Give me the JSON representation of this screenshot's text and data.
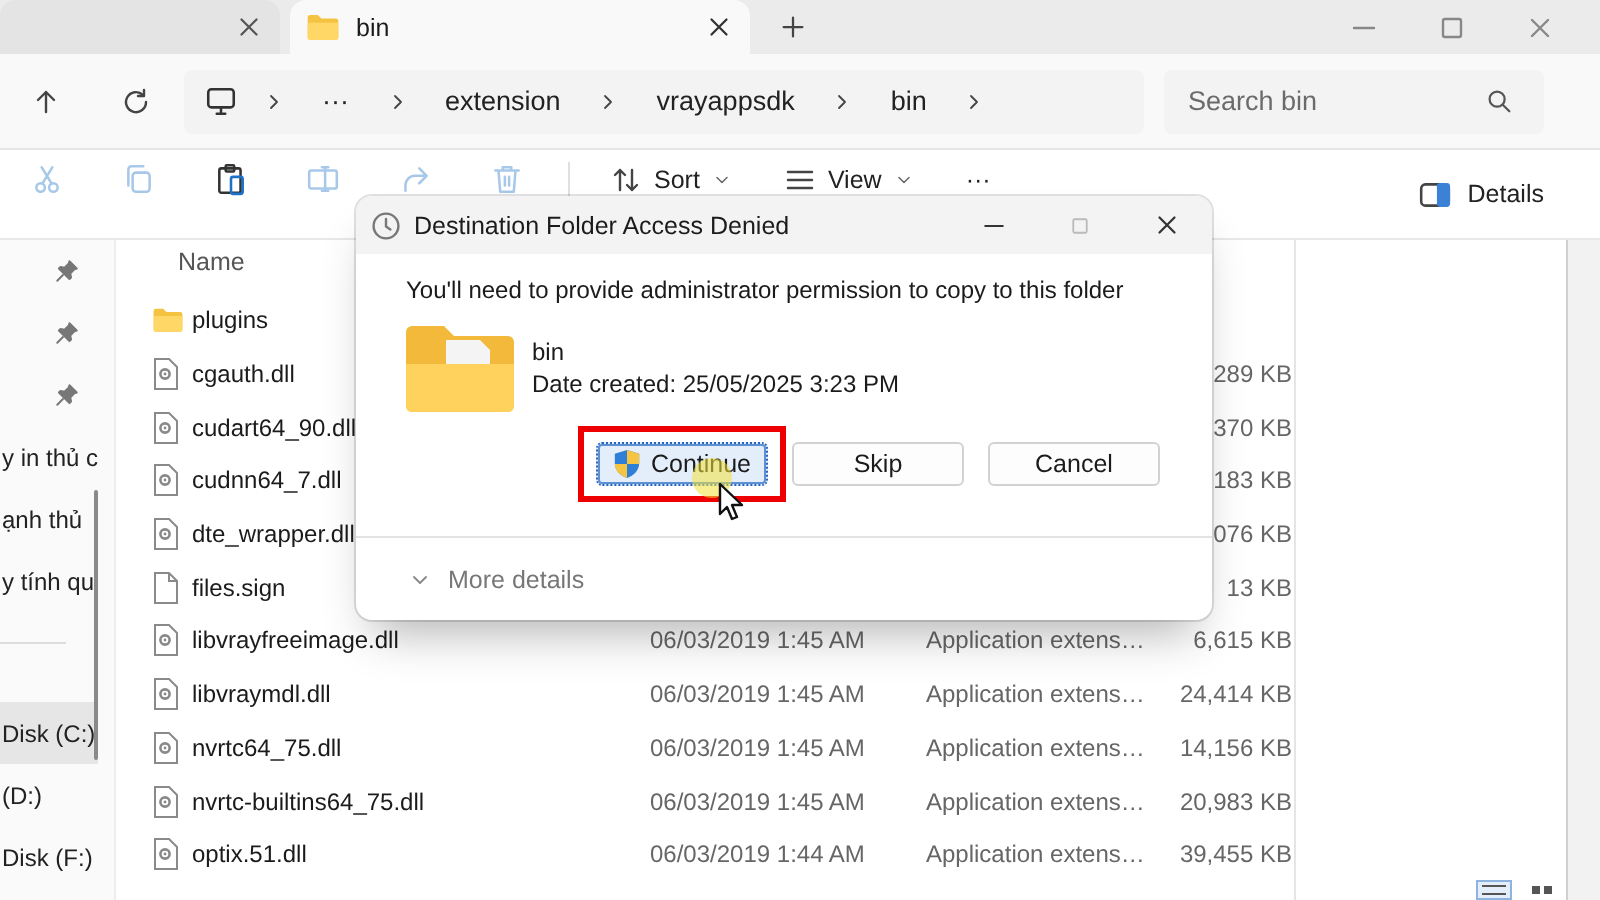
{
  "tabs": [
    {
      "selected": false
    },
    {
      "label": "bin",
      "selected": true
    }
  ],
  "address": {
    "overflow": "···",
    "crumbs": [
      "extension",
      "vrayappsdk",
      "bin"
    ],
    "search": {
      "placeholder": "Search bin"
    }
  },
  "commands": [
    {
      "kind": "cut",
      "disabled": true
    },
    {
      "kind": "copy",
      "disabled": true
    },
    {
      "kind": "paste",
      "disabled": false
    },
    {
      "kind": "rename",
      "disabled": true
    },
    {
      "kind": "share",
      "disabled": true
    },
    {
      "kind": "delete",
      "disabled": true
    }
  ],
  "menus": [
    {
      "kind": "sort",
      "label": "Sort"
    },
    {
      "kind": "view",
      "label": "View"
    },
    {
      "kind": "more",
      "label": "···"
    }
  ],
  "details_button": {
    "label": "Details"
  },
  "sidebar": {
    "items": [
      {
        "pinned": true,
        "selected": false
      },
      {
        "pinned": true,
        "selected": false
      },
      {
        "pinned": true,
        "selected": false
      },
      {
        "label": "y in thủ c",
        "pinned": false,
        "selected": false
      },
      {
        "label": "ạnh thủ",
        "pinned": false,
        "selected": false
      },
      {
        "label": "y tính qu",
        "pinned": false,
        "selected": false
      },
      {
        "kind": "divider"
      },
      {
        "label": "Disk (C:)",
        "pinned": false,
        "selected": true
      },
      {
        "label": "(D:)",
        "pinned": false,
        "selected": false
      },
      {
        "label": "Disk (F:)",
        "pinned": false,
        "selected": false
      }
    ]
  },
  "files": {
    "columns": [
      "Name"
    ],
    "rows": [
      {
        "kind": "folder",
        "name": "plugins"
      },
      {
        "kind": "dll",
        "name": "cgauth.dll",
        "size": "289 KB"
      },
      {
        "kind": "dll",
        "name": "cudart64_90.dll",
        "size": "370 KB"
      },
      {
        "kind": "dll",
        "name": "cudnn64_7.dll",
        "size": "183 KB"
      },
      {
        "kind": "dll",
        "name": "dte_wrapper.dll",
        "size": "076 KB"
      },
      {
        "kind": "file",
        "name": "files.sign",
        "size": "13 KB"
      },
      {
        "kind": "dll",
        "name": "libvrayfreeimage.dll",
        "date": "06/03/2019 1:45 AM",
        "type": "Application extens…",
        "size": "6,615 KB"
      },
      {
        "kind": "dll",
        "name": "libvraymdl.dll",
        "date": "06/03/2019 1:45 AM",
        "type": "Application extens…",
        "size": "24,414 KB"
      },
      {
        "kind": "dll",
        "name": "nvrtc64_75.dll",
        "date": "06/03/2019 1:45 AM",
        "type": "Application extens…",
        "size": "14,156 KB"
      },
      {
        "kind": "dll",
        "name": "nvrtc-builtins64_75.dll",
        "date": "06/03/2019 1:45 AM",
        "type": "Application extens…",
        "size": "20,983 KB"
      },
      {
        "kind": "dll",
        "name": "optix.51.dll",
        "date": "06/03/2019 1:44 AM",
        "type": "Application extens…",
        "size": "39,455 KB"
      }
    ]
  },
  "view_modes": [
    {
      "kind": "details",
      "selected": true
    },
    {
      "kind": "tiles",
      "selected": false
    }
  ],
  "dialog": {
    "title": "Destination Folder Access Denied",
    "message": "You'll need to provide administrator permission to copy to this folder",
    "item": {
      "name": "bin",
      "date": "Date created: 25/05/2025 3:23 PM"
    },
    "buttons": [
      {
        "label": "Continue",
        "elevated": true,
        "default": true,
        "highlighted": true
      },
      {
        "label": "Skip",
        "elevated": false,
        "default": false,
        "highlighted": false
      },
      {
        "label": "Cancel",
        "elevated": false,
        "default": false,
        "highlighted": false
      }
    ],
    "more": "More details"
  }
}
